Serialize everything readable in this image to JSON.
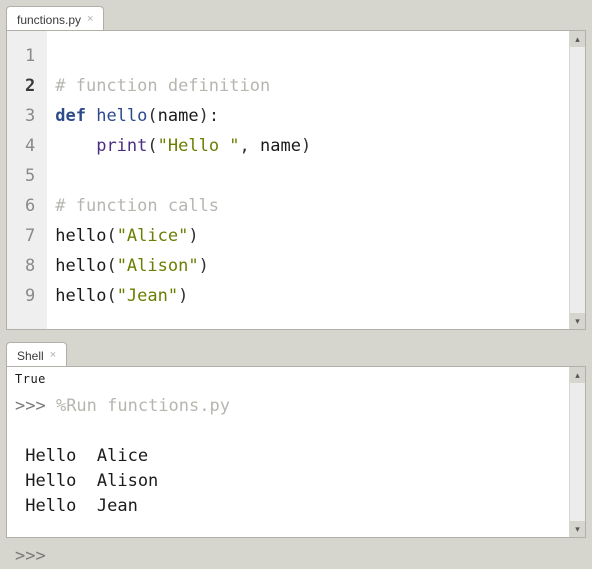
{
  "editor": {
    "tab": {
      "label": "functions.py",
      "close_glyph": "×"
    },
    "caret_line": 2,
    "lines": [
      {
        "n": 1,
        "tokens": []
      },
      {
        "n": 2,
        "tokens": [
          {
            "t": "# function definition",
            "c": "comment"
          }
        ]
      },
      {
        "n": 3,
        "tokens": [
          {
            "t": "def ",
            "c": "keyword"
          },
          {
            "t": "hello",
            "c": "defname"
          },
          {
            "t": "(",
            "c": "paren"
          },
          {
            "t": "name",
            "c": "ident"
          },
          {
            "t": ")",
            "c": "paren"
          },
          {
            "t": ":",
            "c": "punct"
          }
        ]
      },
      {
        "n": 4,
        "tokens": [
          {
            "t": "    ",
            "c": "ident"
          },
          {
            "t": "print",
            "c": "builtin"
          },
          {
            "t": "(",
            "c": "paren"
          },
          {
            "t": "\"Hello \"",
            "c": "string"
          },
          {
            "t": ", ",
            "c": "punct"
          },
          {
            "t": "name",
            "c": "ident"
          },
          {
            "t": ")",
            "c": "paren"
          }
        ]
      },
      {
        "n": 5,
        "tokens": []
      },
      {
        "n": 6,
        "tokens": [
          {
            "t": "# function calls",
            "c": "comment"
          }
        ]
      },
      {
        "n": 7,
        "tokens": [
          {
            "t": "hello",
            "c": "ident"
          },
          {
            "t": "(",
            "c": "paren"
          },
          {
            "t": "\"Alice\"",
            "c": "string"
          },
          {
            "t": ")",
            "c": "paren"
          }
        ]
      },
      {
        "n": 8,
        "tokens": [
          {
            "t": "hello",
            "c": "ident"
          },
          {
            "t": "(",
            "c": "paren"
          },
          {
            "t": "\"Alison\"",
            "c": "string"
          },
          {
            "t": ")",
            "c": "paren"
          }
        ]
      },
      {
        "n": 9,
        "tokens": [
          {
            "t": "hello",
            "c": "ident"
          },
          {
            "t": "(",
            "c": "paren"
          },
          {
            "t": "\"Jean\"",
            "c": "string"
          },
          {
            "t": ")",
            "c": "paren"
          }
        ]
      }
    ]
  },
  "shell": {
    "tab": {
      "label": "Shell",
      "close_glyph": "×"
    },
    "scrolled_off_fragment": "True",
    "prompt": ">>>",
    "command": "%Run functions.py",
    "output_lines": [
      "Hello  Alice",
      "Hello  Alison",
      "Hello  Jean"
    ],
    "trailing_prompt": ">>>"
  },
  "scroll": {
    "up_glyph": "▴",
    "down_glyph": "▾"
  }
}
